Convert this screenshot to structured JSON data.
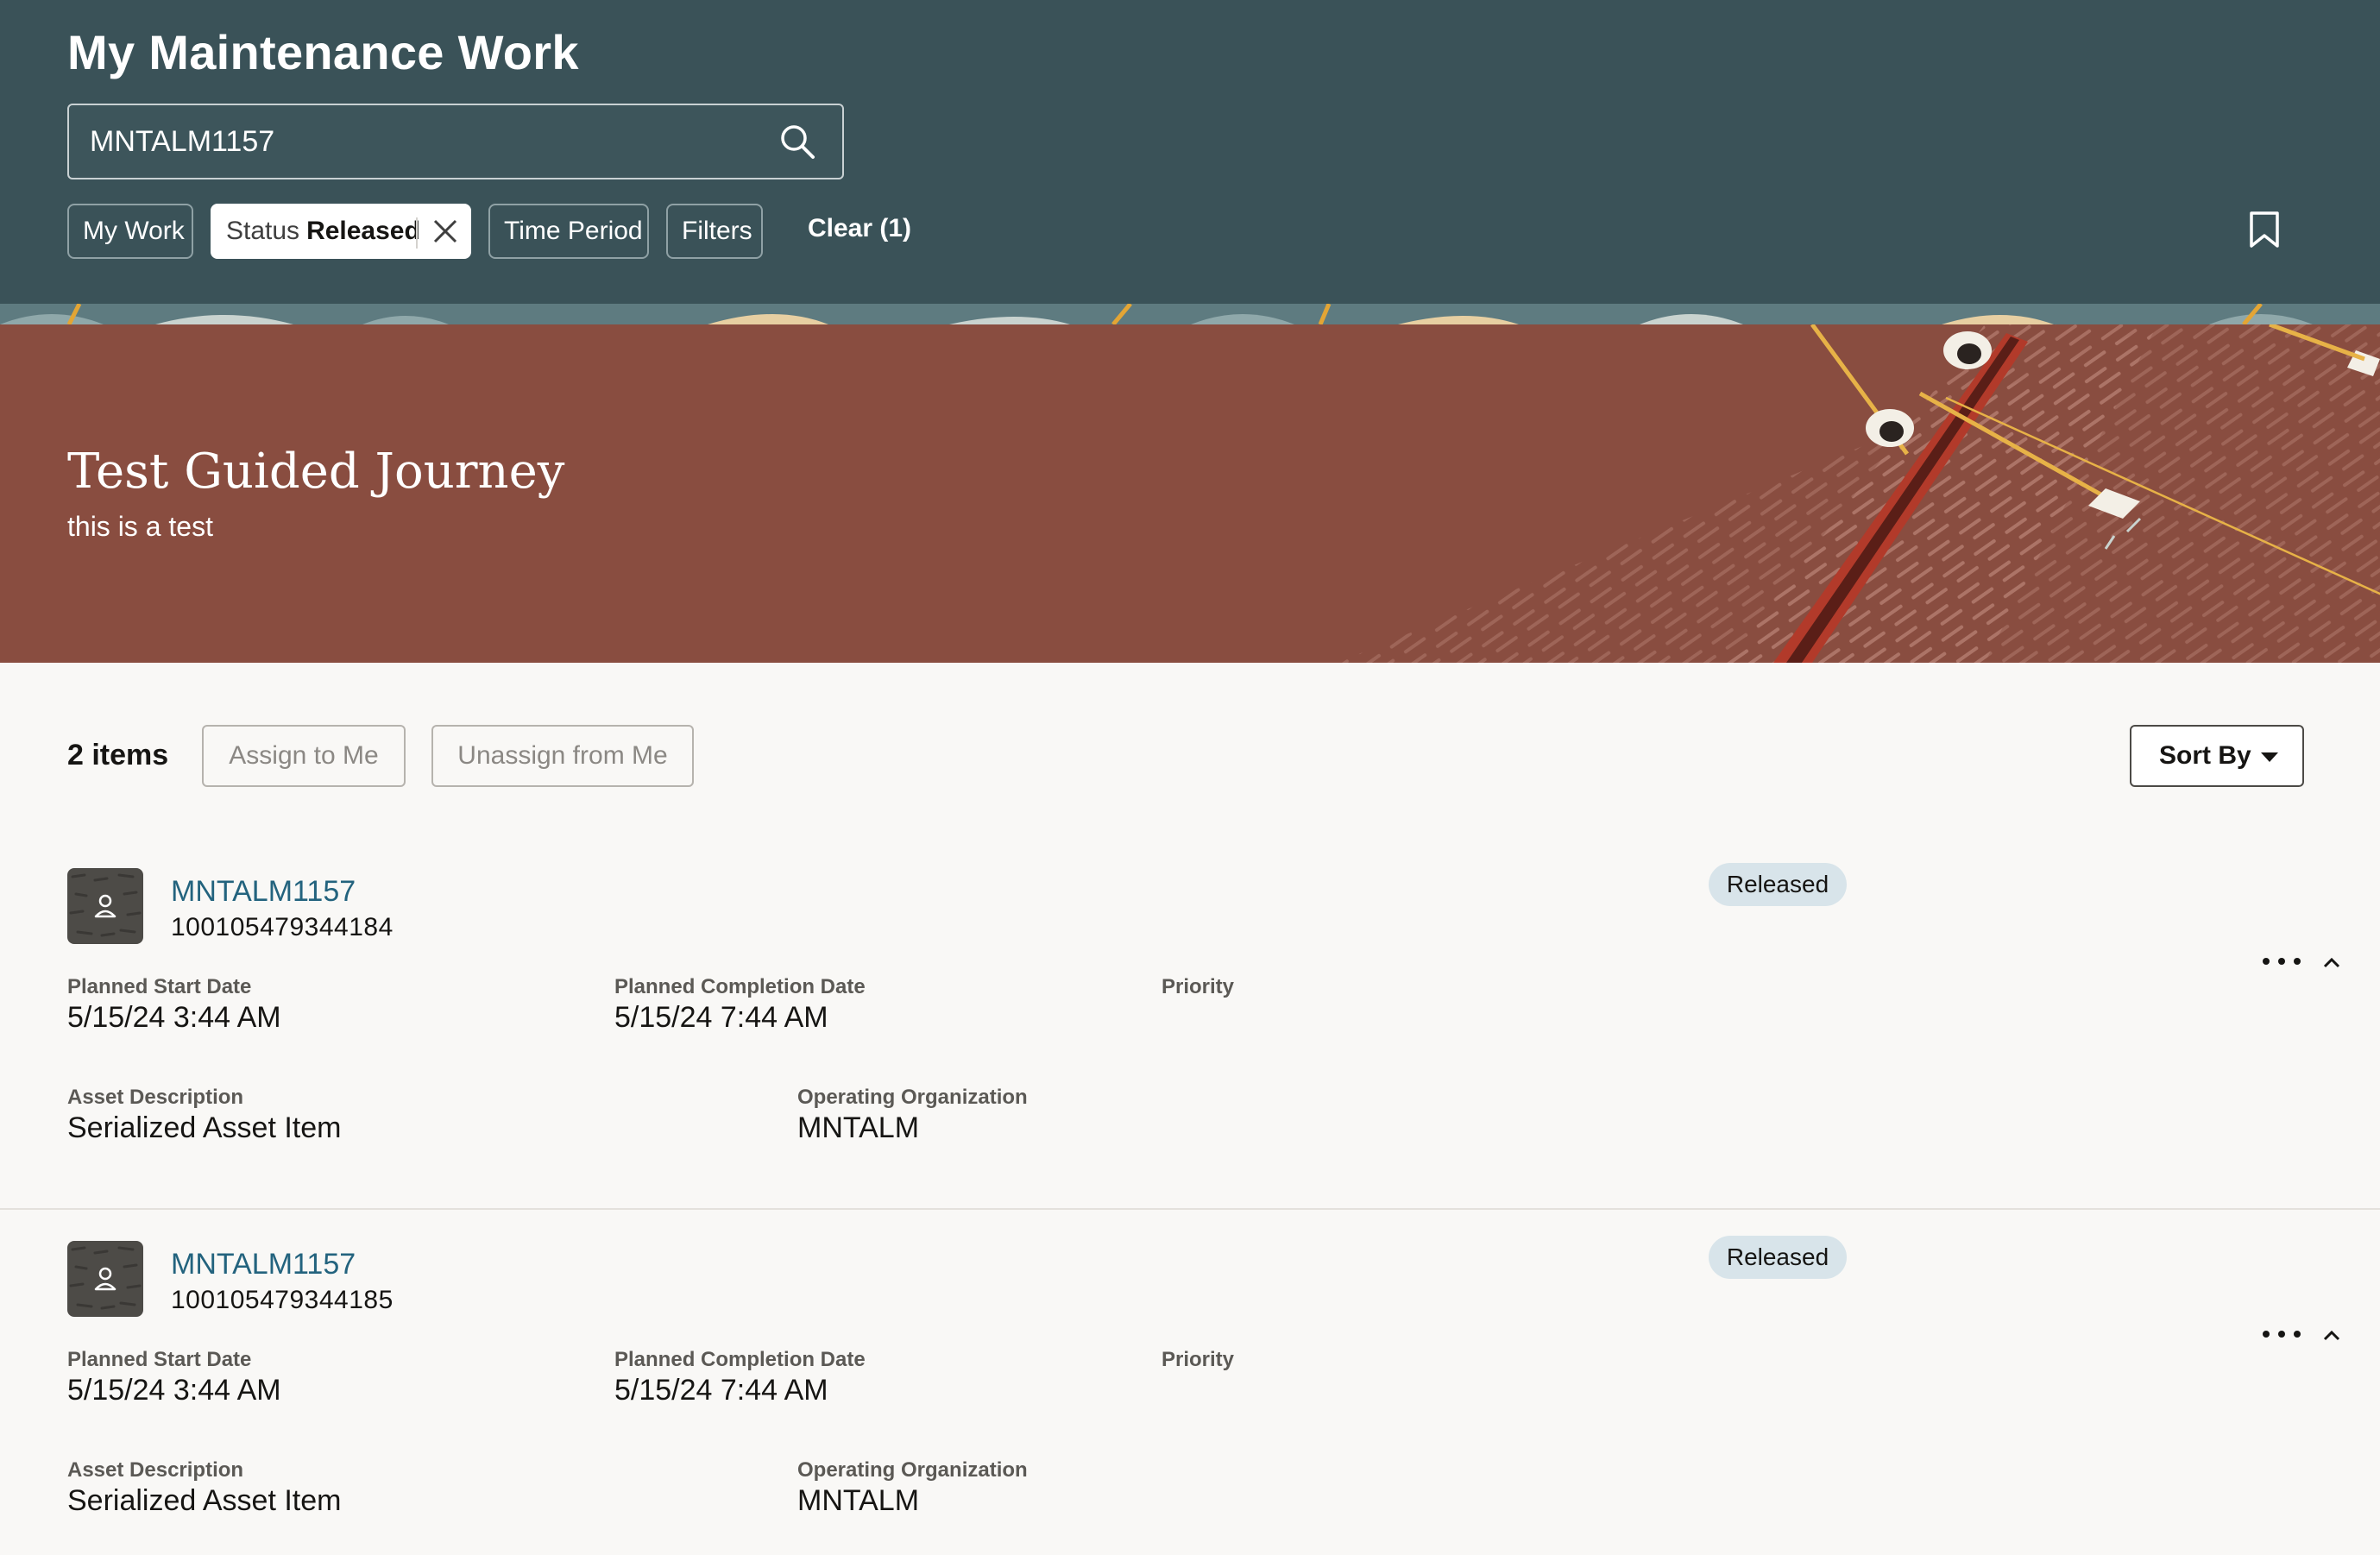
{
  "header": {
    "title": "My Maintenance Work",
    "search": {
      "value": "MNTALM1157",
      "icon": "search-icon"
    },
    "chips": {
      "my_work": "My Work",
      "status_key": "Status",
      "status_value": "Released",
      "time_period": "Time Period",
      "filters": "Filters"
    },
    "clear_label": "Clear (1)",
    "bookmark_icon": "bookmark-icon",
    "colors": {
      "background": "#3a5258",
      "text": "#ffffff"
    }
  },
  "banner": {
    "title": "Test Guided Journey",
    "subtitle": "this is a test",
    "colors": {
      "background": "#894d40"
    }
  },
  "toolbar": {
    "items_count": "2 items",
    "assign_label": "Assign to Me",
    "unassign_label": "Unassign from Me",
    "sort_label": "Sort By"
  },
  "labels": {
    "planned_start": "Planned Start Date",
    "planned_completion": "Planned Completion Date",
    "priority": "Priority",
    "asset_description": "Asset Description",
    "operating_org": "Operating Organization"
  },
  "work_orders": [
    {
      "name": "MNTALM1157",
      "number": "100105479344184",
      "status": "Released",
      "planned_start": "5/15/24 3:44 AM",
      "planned_completion": "5/15/24 7:44 AM",
      "priority": "",
      "asset_description": "Serialized Asset Item",
      "operating_org": "MNTALM"
    },
    {
      "name": "MNTALM1157",
      "number": "100105479344185",
      "status": "Released",
      "planned_start": "5/15/24 3:44 AM",
      "planned_completion": "5/15/24 7:44 AM",
      "priority": "",
      "asset_description": "Serialized Asset Item",
      "operating_org": "MNTALM"
    }
  ],
  "colors": {
    "link": "#23637e",
    "status_badge": "#d8e4ea",
    "page_bg": "#f9f8f6"
  }
}
